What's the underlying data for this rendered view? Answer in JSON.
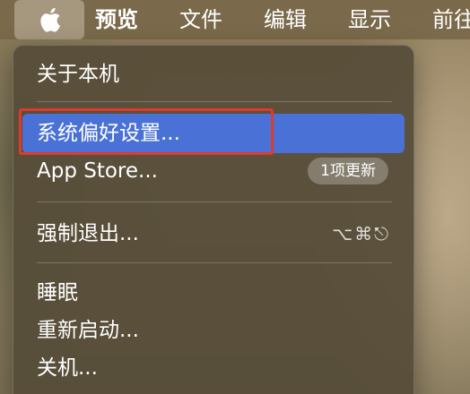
{
  "menubar": {
    "apple_icon": "apple-logo-icon",
    "items": [
      "预览",
      "文件",
      "编辑",
      "显示",
      "前往"
    ]
  },
  "apple_menu": {
    "about": "关于本机",
    "system_prefs": "系统偏好设置...",
    "app_store": "App Store...",
    "app_store_badge": "1项更新",
    "force_quit": "强制退出...",
    "force_quit_shortcut": "⌥⌘⎋",
    "sleep": "睡眠",
    "restart": "重新启动...",
    "shutdown": "关机..."
  },
  "colors": {
    "highlight": "#4a72d6",
    "annotation_box": "#e03a2a"
  }
}
